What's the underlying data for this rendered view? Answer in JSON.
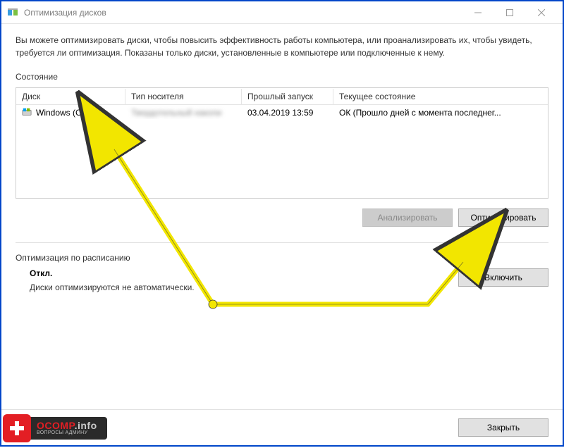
{
  "titlebar": {
    "title": "Оптимизация дисков"
  },
  "description": "Вы можете оптимизировать диски, чтобы повысить эффективность работы  компьютера, или проанализировать их, чтобы увидеть, требуется ли оптимизация. Показаны только диски, установленные в компьютере или подключенные к нему.",
  "status_label": "Состояние",
  "table": {
    "headers": {
      "disk": "Диск",
      "type": "Тип носителя",
      "last": "Прошлый запуск",
      "status": "Текущее состояние"
    },
    "rows": [
      {
        "disk": "Windows (C:)",
        "type": "Твердотельный накопи",
        "last": "03.04.2019 13:59",
        "status": "ОК (Прошло дней с момента последнег..."
      }
    ]
  },
  "buttons": {
    "analyze": "Анализировать",
    "optimize": "Оптимизировать",
    "enable": "Включить",
    "close": "Закрыть"
  },
  "schedule": {
    "label": "Оптимизация по расписанию",
    "title": "Откл.",
    "subtitle": "Диски оптимизируются не автоматически."
  },
  "watermark": {
    "brand": "OCOMP",
    "suffix": ".info",
    "tagline": "ВОПРОСЫ АДМИНУ"
  }
}
